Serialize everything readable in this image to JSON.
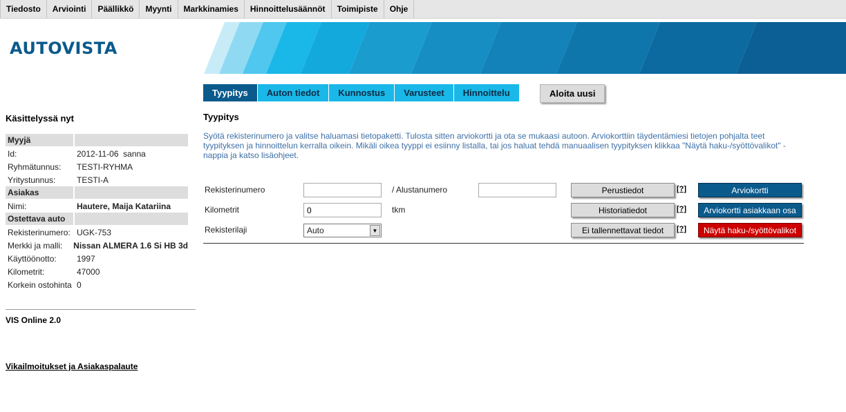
{
  "menu": [
    "Tiedosto",
    "Arviointi",
    "Päällikkö",
    "Myynti",
    "Markkinamies",
    "Hinnoittelusäännöt",
    "Toimipiste",
    "Ohje"
  ],
  "brand": {
    "logo_text": "AUTOVISTA",
    "color": "#0b5a8c",
    "accent": "#1ab8e8"
  },
  "tabs": [
    {
      "label": "Tyypitys",
      "active": true
    },
    {
      "label": "Auton tiedot",
      "active": false
    },
    {
      "label": "Kunnostus",
      "active": false
    },
    {
      "label": "Varusteet",
      "active": false
    },
    {
      "label": "Hinnoittelu",
      "active": false
    }
  ],
  "restart_label": "Aloita uusi",
  "sidebar": {
    "title": "Käsittelyssä nyt",
    "sections": [
      {
        "heading": "Myyjä",
        "rows": [
          {
            "key": "Id:",
            "value": "2012-11-06  sanna"
          },
          {
            "key": "Ryhmätunnus:",
            "value": "TESTI-RYHMA"
          },
          {
            "key": "Yritystunnus:",
            "value": "TESTI-A"
          }
        ]
      },
      {
        "heading": "Asiakas",
        "rows": [
          {
            "key": "Nimi:",
            "value": "Hautere, Maija Katariina",
            "bold": true
          }
        ]
      },
      {
        "heading": "Ostettava auto",
        "rows": [
          {
            "key": "Rekisterinumero:",
            "value": "UGK-753"
          },
          {
            "key": "Merkki ja malli:",
            "value": "Nissan ALMERA 1.6 Si HB 3d",
            "bold": true
          },
          {
            "key": "Käyttöönotto:",
            "value": "1997"
          },
          {
            "key": "Kilometrit:",
            "value": "47000"
          },
          {
            "key": "Korkein ostohinta",
            "value": "0"
          }
        ]
      }
    ],
    "version": "VIS Online 2.0",
    "feedback_link": "Vikailmoitukset ja Asiakaspalaute"
  },
  "main": {
    "section_title": "Tyypitys",
    "intro": "Syötä rekisterinumero ja valitse haluamasi tietopaketti. Tulosta sitten arviokortti ja ota se mukaasi autoon. Arviokorttiin täydentämiesi tietojen pohjalta teet tyypityksen ja hinnoittelun kerralla oikein. Mikäli oikea tyyppi ei esiinny listalla, tai jos haluat tehdä manuaalisen tyypityksen klikkaa \"Näytä haku-/syöttövalikot\" -nappia ja katso lisäohjeet.",
    "form": {
      "reg_label": "Rekisterinumero",
      "reg_value": "",
      "chassis_label": "/ Alustanumero",
      "chassis_value": "",
      "km_label": "Kilometrit",
      "km_value": "0",
      "km_unit": "tkm",
      "regtype_label": "Rekisterilaji",
      "regtype_value": "Auto"
    },
    "buttons": {
      "perustiedot": "Perustiedot",
      "historiatiedot": "Historiatiedot",
      "ei_tallennettavat": "Ei tallennettavat tiedot",
      "help": "[?]",
      "arviokortti": "Arviokortti",
      "arviokortti_asiakas": "Arviokortti asiakkaan osa",
      "nayta_haku": "Näytä haku-/syöttövalikot"
    }
  }
}
